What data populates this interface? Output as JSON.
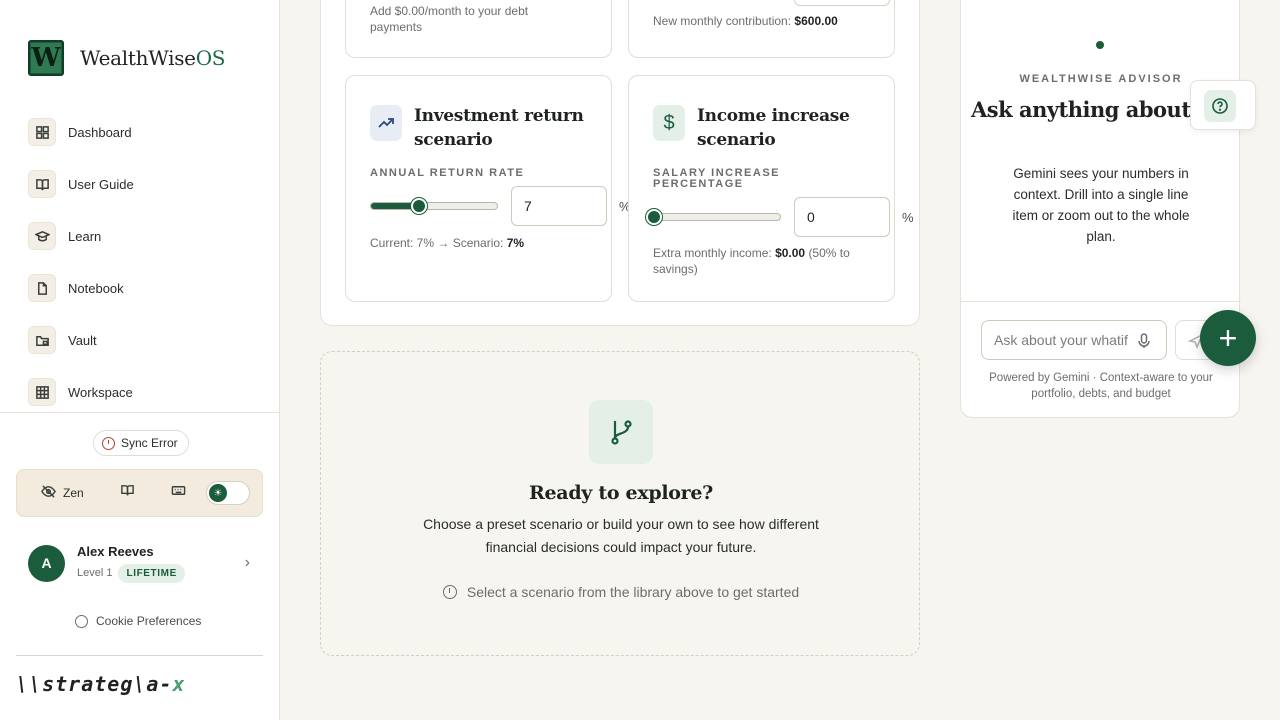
{
  "brand": {
    "logo_letter": "W",
    "name": "WealthWise",
    "suffix": "OS"
  },
  "nav": [
    {
      "label": "Dashboard",
      "icon": "dashboard-icon"
    },
    {
      "label": "User Guide",
      "icon": "book-icon"
    },
    {
      "label": "Learn",
      "icon": "graduation-cap-icon"
    },
    {
      "label": "Notebook",
      "icon": "file-icon"
    },
    {
      "label": "Vault",
      "icon": "folder-lock-icon"
    },
    {
      "label": "Workspace",
      "icon": "grid-icon"
    }
  ],
  "sync": {
    "label": "Sync Error"
  },
  "toolbar": {
    "zen_label": "Zen"
  },
  "user": {
    "initial": "A",
    "name": "Alex Reeves",
    "level": "Level 1",
    "badge": "LIFETIME"
  },
  "cookie": {
    "label": "Cookie Preferences"
  },
  "wordmark": {
    "main": "\\\\strateg\\a-",
    "accent": "x"
  },
  "top_cards": {
    "debt_text": "Add $0.00/month to your debt payments",
    "contrib_prefix": "New monthly contribution:",
    "contrib_value": "$600.00"
  },
  "investment": {
    "title": "Investment return scenario",
    "label": "ANNUAL RETURN RATE",
    "value": "7",
    "unit": "%",
    "slider_fraction": 0.375,
    "current_prefix": "Current: 7% → Scenario:",
    "current_value": "7%"
  },
  "income": {
    "title": "Income increase scenario",
    "label": "SALARY INCREASE PERCENTAGE",
    "value": "0",
    "unit": "%",
    "slider_fraction": 0,
    "extra_prefix": "Extra monthly income:",
    "extra_value": "$0.00",
    "extra_suffix": "(50% to savings)"
  },
  "explore": {
    "title": "Ready to explore?",
    "description": "Choose a preset scenario or build your own to see how different financial decisions could impact your future.",
    "hint": "Select a scenario from the library above to get started"
  },
  "advisor": {
    "eyebrow": "WEALTHWISE ADVISOR",
    "title": "Ask anything about your whatif.",
    "description": "Gemini sees your numbers in context. Drill into a single line item or zoom out to the whole plan.",
    "input_placeholder": "Ask about your whatif",
    "footer": "Powered by Gemini · Context-aware to your portfolio, debts, and budget"
  },
  "colors": {
    "accent": "#1a5c3c",
    "background": "#f7f5f0",
    "error": "#b4413a"
  }
}
